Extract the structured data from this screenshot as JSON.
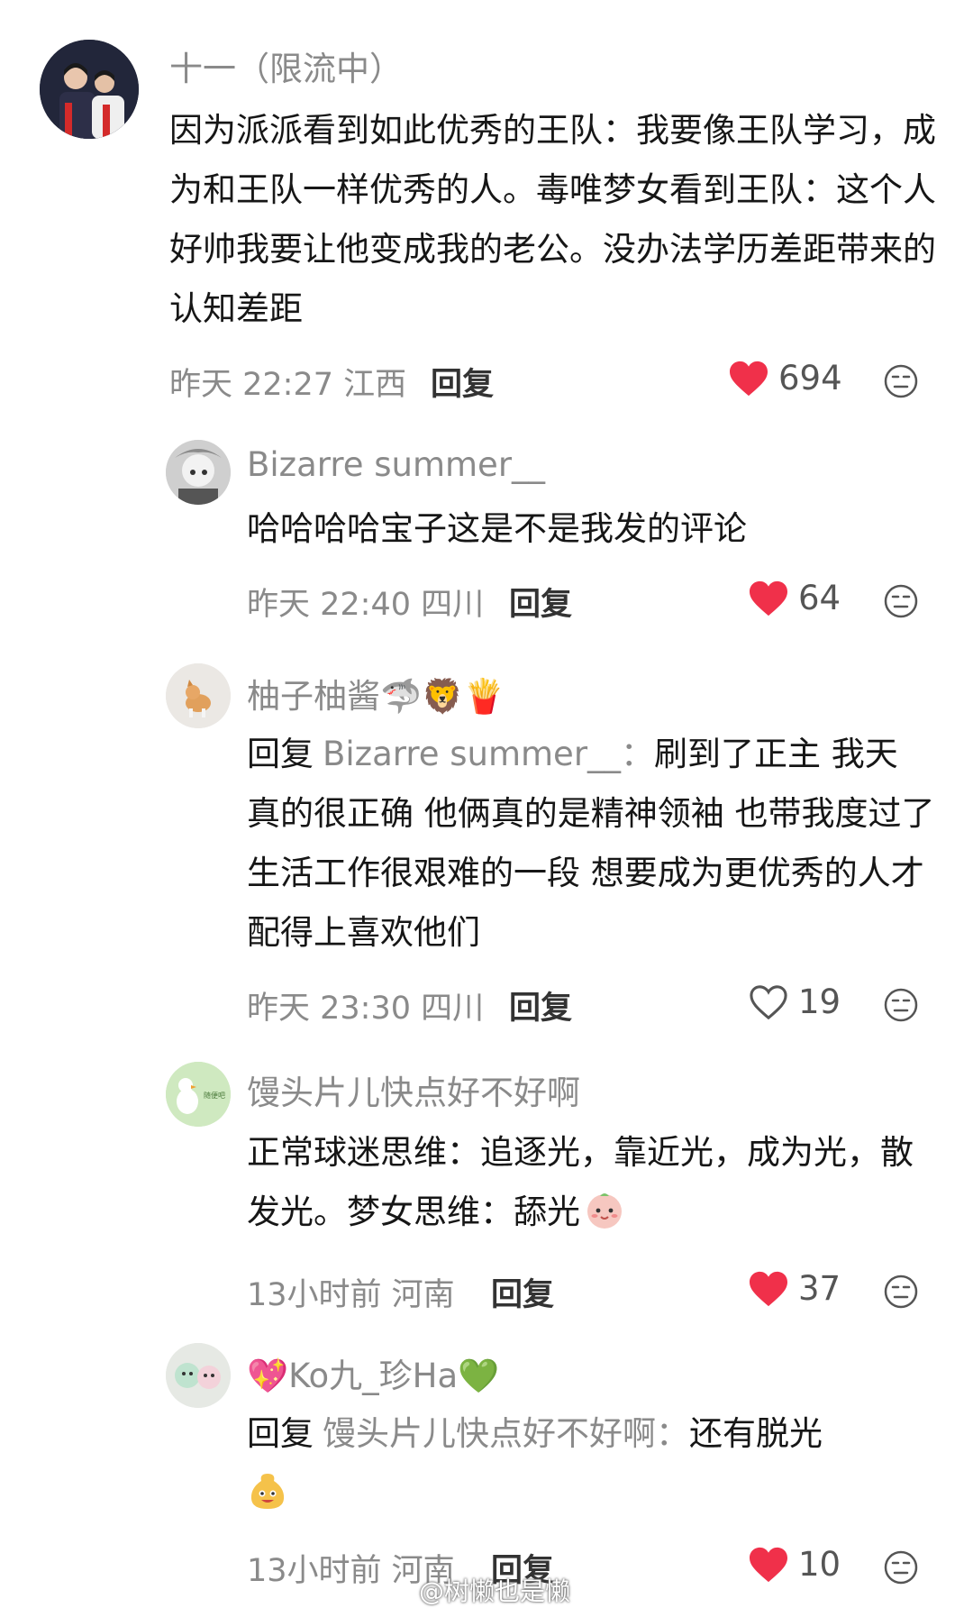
{
  "comments": [
    {
      "username": "十一（限流中）",
      "text": "因为派派看到如此优秀的王队：我要像王队学习，成为和王队一样优秀的人。毒唯梦女看到王队：这个人好帅我要让他变成我的老公。没办法学历差距带来的认知差距",
      "time": "昨天 22:27 江西",
      "reply_label": "回复",
      "likes": "694",
      "liked": true
    },
    {
      "username": "Bizarre summer__",
      "text": "哈哈哈哈宝子这是不是我发的评论",
      "time": "昨天 22:40 四川",
      "reply_label": "回复",
      "likes": "64",
      "liked": true
    },
    {
      "username": "柚子柚酱🦈🦁🍟",
      "reply_prefix": "回复",
      "reply_to": "Bizarre summer__：",
      "text": "刷到了正主 我天 真的很正确 他俩真的是精神领袖 也带我度过了生活工作很艰难的一段 想要成为更优秀的人才配得上喜欢他们",
      "time": "昨天 23:30 四川",
      "reply_label": "回复",
      "likes": "19",
      "liked": false
    },
    {
      "username": "馒头片儿快点好不好啊",
      "text": "正常球迷思维：追逐光，靠近光，成为光，散发光。梦女思维：舔光",
      "time": "13小时前 河南",
      "reply_label": "回复",
      "likes": "37",
      "liked": true
    },
    {
      "username": "💖Ko九_珍Ha💚",
      "reply_prefix": "回复",
      "reply_to": "馒头片儿快点好不好啊：",
      "text": "还有脱光",
      "time": "13小时前 河南",
      "reply_label": "回复",
      "likes": "10",
      "liked": true
    }
  ],
  "avatar_badge": "随便吧",
  "watermark": "@树懒也是懒",
  "colors": {
    "heart": "#f0304a",
    "muted": "#8a8a8a"
  }
}
